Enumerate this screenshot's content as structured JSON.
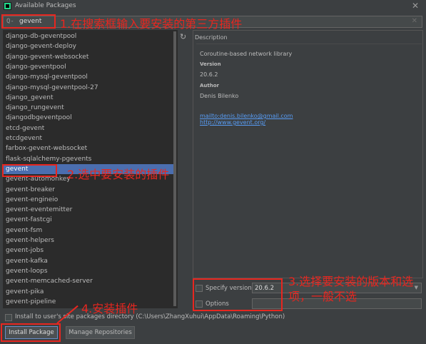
{
  "window": {
    "title": "Available Packages"
  },
  "search": {
    "icon": "Q-",
    "value": "gevent"
  },
  "packages": [
    "django-db-geventpool",
    "django-gevent-deploy",
    "django-gevent-websocket",
    "django-geventpool",
    "django-mysql-geventpool",
    "django-mysql-geventpool-27",
    "django_gevent",
    "django_rungevent",
    "djangodbgeventpool",
    "etcd-gevent",
    "etcdgevent",
    "farbox-gevent-websocket",
    "flask-sqlalchemy-pgevents",
    "gevent",
    "gevent-automonkey",
    "gevent-breaker",
    "gevent-engineio",
    "gevent-eventemitter",
    "gevent-fastcgi",
    "gevent-fsm",
    "gevent-helpers",
    "gevent-jobs",
    "gevent-kafka",
    "gevent-loops",
    "gevent-memcached-server",
    "gevent-pika",
    "gevent-pipeline"
  ],
  "selected_package": "gevent",
  "description": {
    "section_label": "Description",
    "summary": "Coroutine-based network library",
    "version_label": "Version",
    "version": "20.6.2",
    "author_label": "Author",
    "author": "Denis Bilenko",
    "email_link": "mailto:denis.bilenko@gmail.com",
    "homepage_link": "http://www.gevent.org/"
  },
  "options": {
    "specify_version_label": "Specify version",
    "specify_version_value": "20.6.2",
    "options_label": "Options",
    "user_site_label": "Install to user's site packages directory (C:\\Users\\ZhangXuhui\\AppData\\Roaming\\Python)"
  },
  "buttons": {
    "install": "Install Package",
    "manage": "Manage Repositories"
  },
  "annotations": {
    "step1": "1.在搜索框输入要安装的第三方插件",
    "step2": "2.选中要安装的插件",
    "step3_line1": "3.选择要安装的版本和选",
    "step3_line2": "项，一般不选",
    "step4": "4.安装插件"
  },
  "colors": {
    "accent": "#4b6eaf",
    "annotation": "#e8261f",
    "link": "#589df6"
  }
}
